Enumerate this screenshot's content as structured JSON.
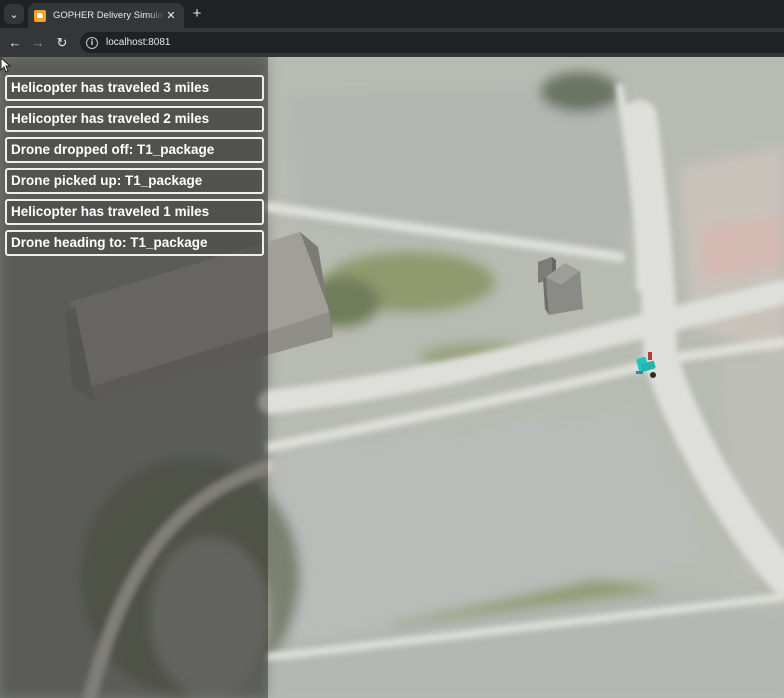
{
  "browser": {
    "tab_title": "GOPHER Delivery Simulation Sy",
    "tab_close_icon": "close-icon",
    "new_tab_symbol": "+",
    "url": "localhost:8081",
    "favicon_color": "#f4a22d"
  },
  "toolbar": {
    "back_symbol": "←",
    "forward_symbol": "→",
    "reload_symbol": "↻",
    "info_symbol": "i"
  },
  "simulation": {
    "log_messages": [
      "Helicopter has traveled 3 miles",
      "Helicopter has traveled 2 miles",
      "Drone dropped off: T1_package",
      "Drone picked up: T1_package",
      "Helicopter has traveled 1 miles",
      "Drone heading to: T1_package"
    ],
    "drone_color": "#1fc7c2"
  }
}
